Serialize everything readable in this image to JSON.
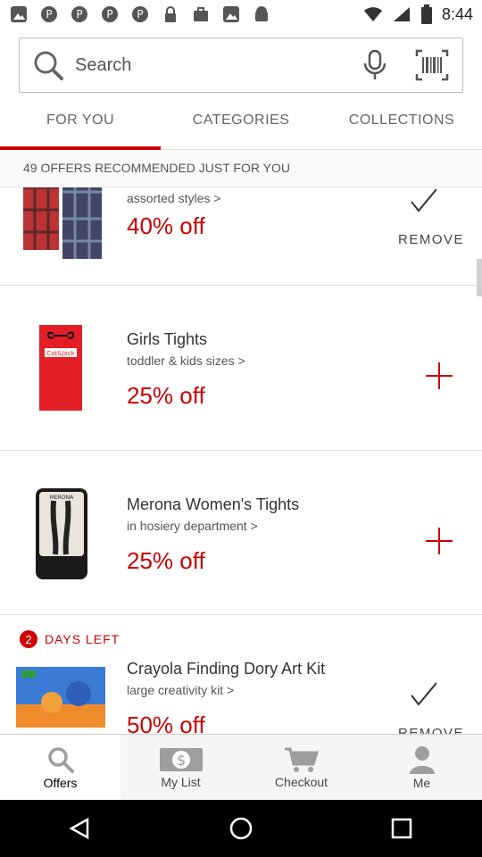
{
  "status": {
    "time": "8:44"
  },
  "search": {
    "placeholder": "Search"
  },
  "tabs": [
    {
      "label": "FOR YOU",
      "active": true
    },
    {
      "label": "CATEGORIES",
      "active": false
    },
    {
      "label": "COLLECTIONS",
      "active": false
    }
  ],
  "banner": {
    "text": "49 OFFERS RECOMMENDED JUST FOR YOU"
  },
  "offers": [
    {
      "title": "",
      "sub": "assorted styles >",
      "discount": "40% off",
      "action": "remove",
      "action_label": "REMOVE"
    },
    {
      "title": "Girls Tights",
      "sub": "toddler & kids sizes >",
      "discount": "25% off",
      "action": "add"
    },
    {
      "title": "Merona Women's Tights",
      "sub": "in hosiery department >",
      "discount": "25% off",
      "action": "add"
    },
    {
      "title": "Crayola Finding Dory Art Kit",
      "sub": "large creativity kit >",
      "discount": "50% off",
      "action": "remove",
      "action_label": "REMOVE",
      "days_left": "2",
      "days_left_text": "DAYS LEFT"
    }
  ],
  "bottom_nav": [
    {
      "label": "Offers",
      "icon": "search-icon",
      "active": true
    },
    {
      "label": "My List",
      "icon": "dollar-icon",
      "active": false
    },
    {
      "label": "Checkout",
      "icon": "cart-icon",
      "active": false
    },
    {
      "label": "Me",
      "icon": "person-icon",
      "active": false
    }
  ],
  "colors": {
    "accent": "#cc0000",
    "nav_bg": "#f5f5f5",
    "icon_grey": "#9e9e9e"
  }
}
